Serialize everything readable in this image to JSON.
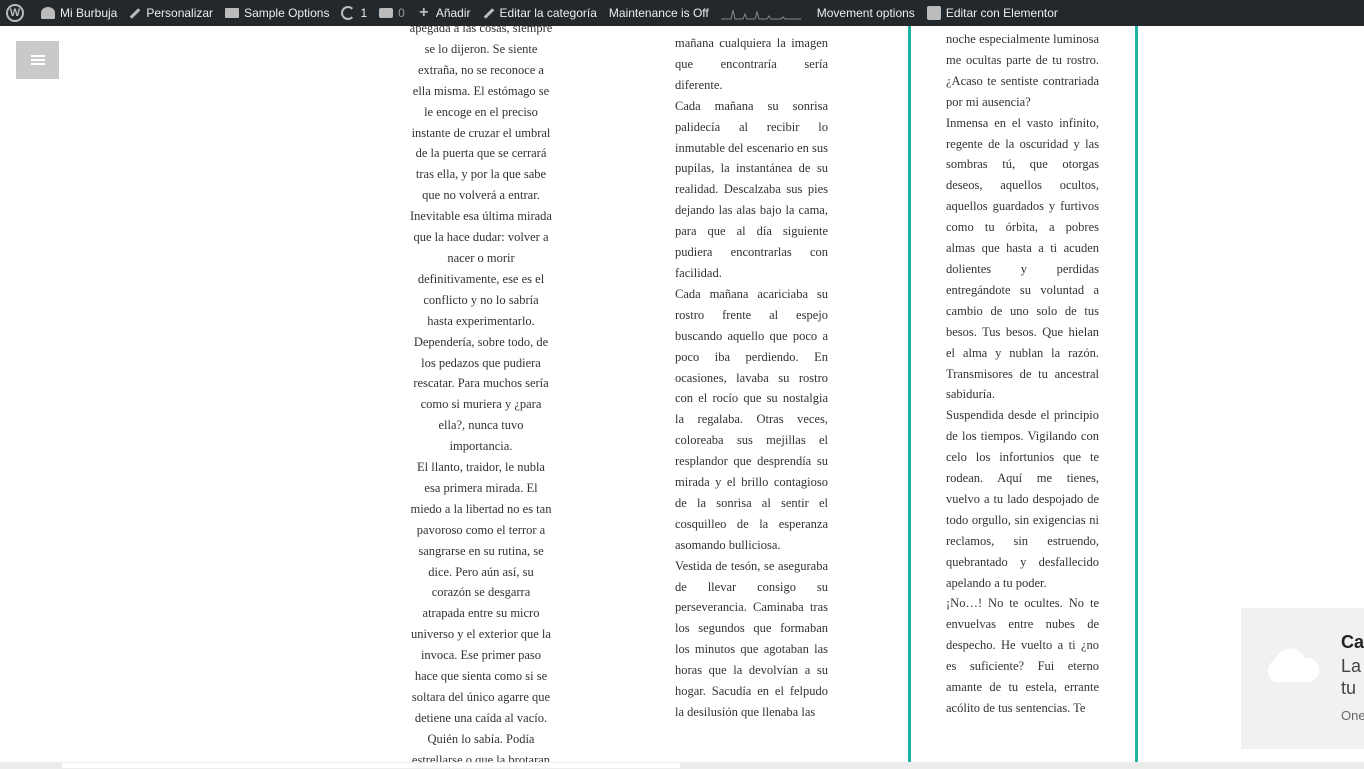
{
  "adminbar": {
    "items": [
      {
        "label": "Mi Burbuja"
      },
      {
        "label": "Personalizar"
      },
      {
        "label": "Sample Options"
      },
      {
        "label": "1"
      },
      {
        "label": "0"
      },
      {
        "label": "Añadir"
      },
      {
        "label": "Editar la categoría"
      },
      {
        "label": "Maintenance is Off"
      },
      {
        "label": "Movement options"
      },
      {
        "label": "Editar con Elementor"
      }
    ]
  },
  "column1": [
    "apegada a las cosas, siempre",
    "se lo dijeron. Se siente",
    "extraña, no se reconoce a",
    "ella misma. El estómago se",
    "le encoge en el preciso",
    "instante de cruzar el umbral",
    "de la puerta que se cerrará",
    "tras ella, y por la que sabe",
    "que no volverá a entrar.",
    "Inevitable esa última mirada",
    "que la hace dudar: volver a",
    "nacer o morir",
    "definitivamente, ese es el",
    "conflicto y no lo sabría",
    "hasta experimentarlo.",
    "Dependería, sobre todo, de",
    "los pedazos que pudiera",
    "rescatar. Para muchos sería",
    "como si muriera y ¿para",
    "ella?, nunca tuvo",
    "importancia.",
    "El llanto, traidor, le nubla",
    "esa primera mirada. El",
    "miedo a la libertad no es tan",
    "pavoroso como el terror a",
    "sangrarse en su rutina, se",
    "dice. Pero aún así, su",
    "corazón se desgarra",
    "atrapada entre su micro",
    "universo y el exterior que la",
    "invoca. Ese primer paso",
    "hace que sienta como si se",
    "soltara del único agarre que",
    "detiene una caída al vacío.",
    "Quién lo sabía. Podía",
    "estrellarse o que la brotaran"
  ],
  "column2": [
    "mañana cualquiera la imagen que encontraría sería diferente.",
    "Cada mañana su sonrisa palidecía al recibir lo inmutable del escenario en sus pupilas, la instantánea de su realidad. Descalzaba sus pies dejando las alas bajo la cama, para que al día siguiente pudiera encontrarlas con facilidad.",
    "Cada mañana acariciaba su rostro frente al espejo buscando aquello que poco a poco iba perdiendo. En ocasiones, lavaba su rostro con el rocío que su nostalgia la regalaba. Otras veces, coloreaba sus mejillas el resplandor que desprendía su mirada y el brillo contagioso de la sonrisa al sentir el cosquilleo de la esperanza asomando bulliciosa.",
    "Vestida de tesón, se aseguraba de llevar consigo su perseverancia. Caminaba tras los segundos que formaban los minutos que agotaban las horas que la devolvían a su hogar. Sacudía en el felpudo la desilusión que llenaba las"
  ],
  "column3": [
    "noche especialmente luminosa me ocultas parte de tu rostro. ¿Acaso te sentiste contrariada por mi ausencia?",
    "Inmensa en el vasto infinito, regente de la oscuridad y las sombras tú, que otorgas deseos, aquellos ocultos, aquellos guardados y furtivos como tu órbita, a pobres almas que hasta a ti acuden dolientes y perdidas entregándote su voluntad a cambio de uno solo de tus besos. Tus besos. Que hielan el alma y nublan la razón. Transmisores de tu ancestral sabiduría.",
    "Suspendida desde el principio de los tiempos. Vigilando con celo los infortunios que te rodean. Aquí me tienes, vuelvo a tu lado despojado de todo orgullo, sin exigencias ni reclamos, sin estruendo, quebrantado y desfallecido apelando a tu poder.",
    "¡No…! No te ocultes. No te envuelvas entre nubes de despecho. He vuelto a ti ¿no es suficiente? Fui eterno amante de tu estela, errante acólito de tus sentencias. Te"
  ],
  "toast": {
    "title": "Ca",
    "line1": "La",
    "line2": "tu",
    "sub": "One"
  },
  "colors": {
    "adminbar_bg": "#23282d",
    "accent_border": "#1fb4a2",
    "menu_button": "#c9c9c9"
  }
}
